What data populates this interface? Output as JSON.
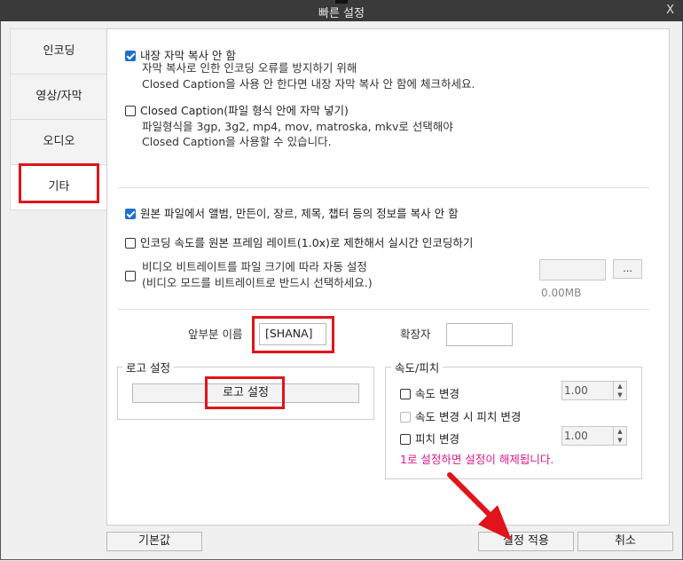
{
  "window": {
    "title": "빠른 설정",
    "close_label": "X"
  },
  "tabs": [
    {
      "label": "인코딩"
    },
    {
      "label": "영상/자막"
    },
    {
      "label": "오디오"
    },
    {
      "label": "기타"
    }
  ],
  "options": {
    "no_copy_subtitles": {
      "label": "내장 자막 복사 안 함",
      "checked": true,
      "desc1": "자막 복사로 인한 인코딩 오류를 방지하기 위해",
      "desc2": "Closed Caption을 사용 안 한다면 내장 자막 복사 안 함에 체크하세요."
    },
    "closed_caption": {
      "label": "Closed Caption(파일 형식 안에 자막 넣기)",
      "checked": false,
      "desc1": "파일형식을 3gp, 3g2, mp4, mov, matroska, mkv로 선택해야",
      "desc2": "Closed Caption을 사용할 수 있습니다."
    },
    "no_copy_metadata": {
      "label": "원본 파일에서 앨범, 만든이, 장르, 제목, 챕터 등의 정보를 복사 안 함",
      "checked": true
    },
    "limit_speed": {
      "label": "인코딩 속도를 원본 프레임 레이트(1.0x)로 제한해서 실시간 인코딩하기",
      "checked": false
    },
    "auto_bitrate": {
      "label1": "비디오 비트레이트를 파일 크기에 따라 자동 설정",
      "label2": "(비디오 모드를 비트레이트로 반드시 선택하세요.)",
      "checked": false,
      "size_value": "",
      "browse_label": "...",
      "size_text": "0.00MB"
    }
  },
  "prefix": {
    "label": "앞부분 이름",
    "value": "[SHANA]"
  },
  "extension": {
    "label": "확장자",
    "value": ""
  },
  "logo": {
    "legend": "로고 설정",
    "button_label": "로고 설정"
  },
  "speed_pitch": {
    "legend": "속도/피치",
    "speed_change": {
      "label": "속도 변경",
      "checked": false,
      "value": "1.00"
    },
    "pitch_on_speed": {
      "label": "속도 변경 시 피치 변경",
      "checked": false,
      "disabled": true
    },
    "pitch_change": {
      "label": "피치 변경",
      "checked": false,
      "value": "1.00"
    },
    "note": "1로 설정하면 설정이 해제됩니다."
  },
  "footer": {
    "default_label": "기본값",
    "apply_label": "설정 적용",
    "cancel_label": "취소"
  },
  "colors": {
    "highlight": "#e0141a",
    "note": "#e0198a",
    "checkbox": "#1e6fcf",
    "titlebar": "#3a3a3a"
  }
}
